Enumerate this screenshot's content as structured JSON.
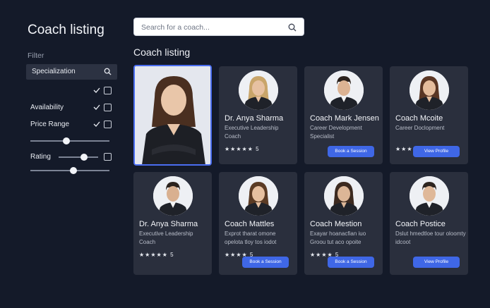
{
  "sidebar": {
    "title": "Coach listing",
    "filter_label": "Filter",
    "specialization_label": "Specialization",
    "availability_label": "Availability",
    "price_range_label": "Price Range",
    "rating_label": "Rating",
    "price_slider_level": 0.45,
    "rating_slider_levels": [
      0.82,
      0.55
    ]
  },
  "search": {
    "placeholder": "Search for a coach..."
  },
  "main": {
    "title": "Coach listing"
  },
  "colors": {
    "accent": "#3f67e6",
    "background": "#141a29",
    "card": "#2a2f3d"
  },
  "cards": [
    {
      "name": "",
      "role": "",
      "rating": "",
      "button": "",
      "featured": true
    },
    {
      "name": "Dr. Anya Sharma",
      "role": "Executive Leadership Coach",
      "rating": "★★★★★ 5",
      "button": ""
    },
    {
      "name": "Coach Mark Jensen",
      "role": "Career Development Specialist",
      "rating": "",
      "button": "Book a Session"
    },
    {
      "name": "Coach Mcoite",
      "role": "Career Doclopment",
      "rating": "★★★★ 5",
      "button": "View Profile"
    },
    {
      "name": "Dr. Anya Sharma",
      "role": "Executive Leadership Coach",
      "rating": "★★★★★ 5",
      "button": ""
    },
    {
      "name": "Coach Mattles",
      "role": "Exprot tharat omone opelota tloy tos iodot",
      "rating": "★★★★ 5",
      "button": "Book a Session"
    },
    {
      "name": "Coach Mestion",
      "role": "Exayar hoanacfian iuo Groou tut aco opoite",
      "rating": "★★★★ 5",
      "button": "Book a Session"
    },
    {
      "name": "Coach Postice",
      "role": "Dslut hmedtloe tour oloomty idcoot",
      "rating": "",
      "button": "View Profile"
    }
  ]
}
